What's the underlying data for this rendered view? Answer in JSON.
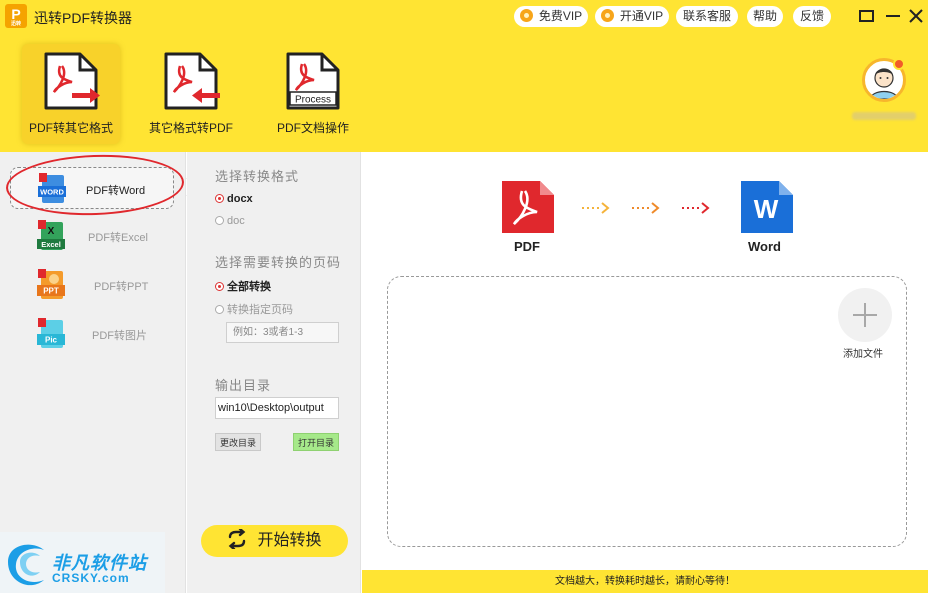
{
  "app": {
    "title": "迅转PDF转换器",
    "logo_letter": "P",
    "logo_sub": "迅转"
  },
  "titlebar": {
    "free_vip": "免费VIP",
    "open_vip": "开通VIP",
    "contact": "联系客服",
    "help": "帮助",
    "feedback": "反馈"
  },
  "toolbar": {
    "tools": [
      {
        "label": "PDF转其它格式",
        "active": true
      },
      {
        "label": "其它格式转PDF",
        "active": false
      },
      {
        "label": "PDF文档操作",
        "active": false,
        "icon_text": "Process"
      }
    ]
  },
  "sidebar": {
    "items": [
      {
        "label": "PDF转Word",
        "icon_text": "WORD",
        "active": true
      },
      {
        "label": "PDF转Excel",
        "icon_text": "Excel",
        "active": false
      },
      {
        "label": "PDF转PPT",
        "icon_text": "PPT",
        "active": false
      },
      {
        "label": "PDF转图片",
        "icon_text": "Pic",
        "active": false
      }
    ]
  },
  "options": {
    "format_title": "选择转换格式",
    "formats": [
      {
        "label": "docx",
        "selected": true
      },
      {
        "label": "doc",
        "selected": false
      }
    ],
    "pages_title": "选择需要转换的页码",
    "pages": [
      {
        "label": "全部转换",
        "selected": true
      },
      {
        "label": "转换指定页码",
        "selected": false
      }
    ],
    "page_placeholder": "例如：3或者1-3",
    "output_title": "输出目录",
    "output_path": "win10\\Desktop\\output",
    "change_dir": "更改目录",
    "open_dir": "打开目录",
    "start": "开始转换"
  },
  "main": {
    "flow": {
      "from": "PDF",
      "to": "Word",
      "to_icon": "W"
    },
    "add_file": "添加文件",
    "footer": "文档越大，转换耗时越长，请耐心等待！"
  },
  "watermark": {
    "cn": "非凡软件站",
    "en": "CRSKY.com"
  },
  "colors": {
    "brand_yellow": "#ffe433",
    "pdf_red": "#e0282d",
    "word_blue": "#1a6fd8"
  }
}
